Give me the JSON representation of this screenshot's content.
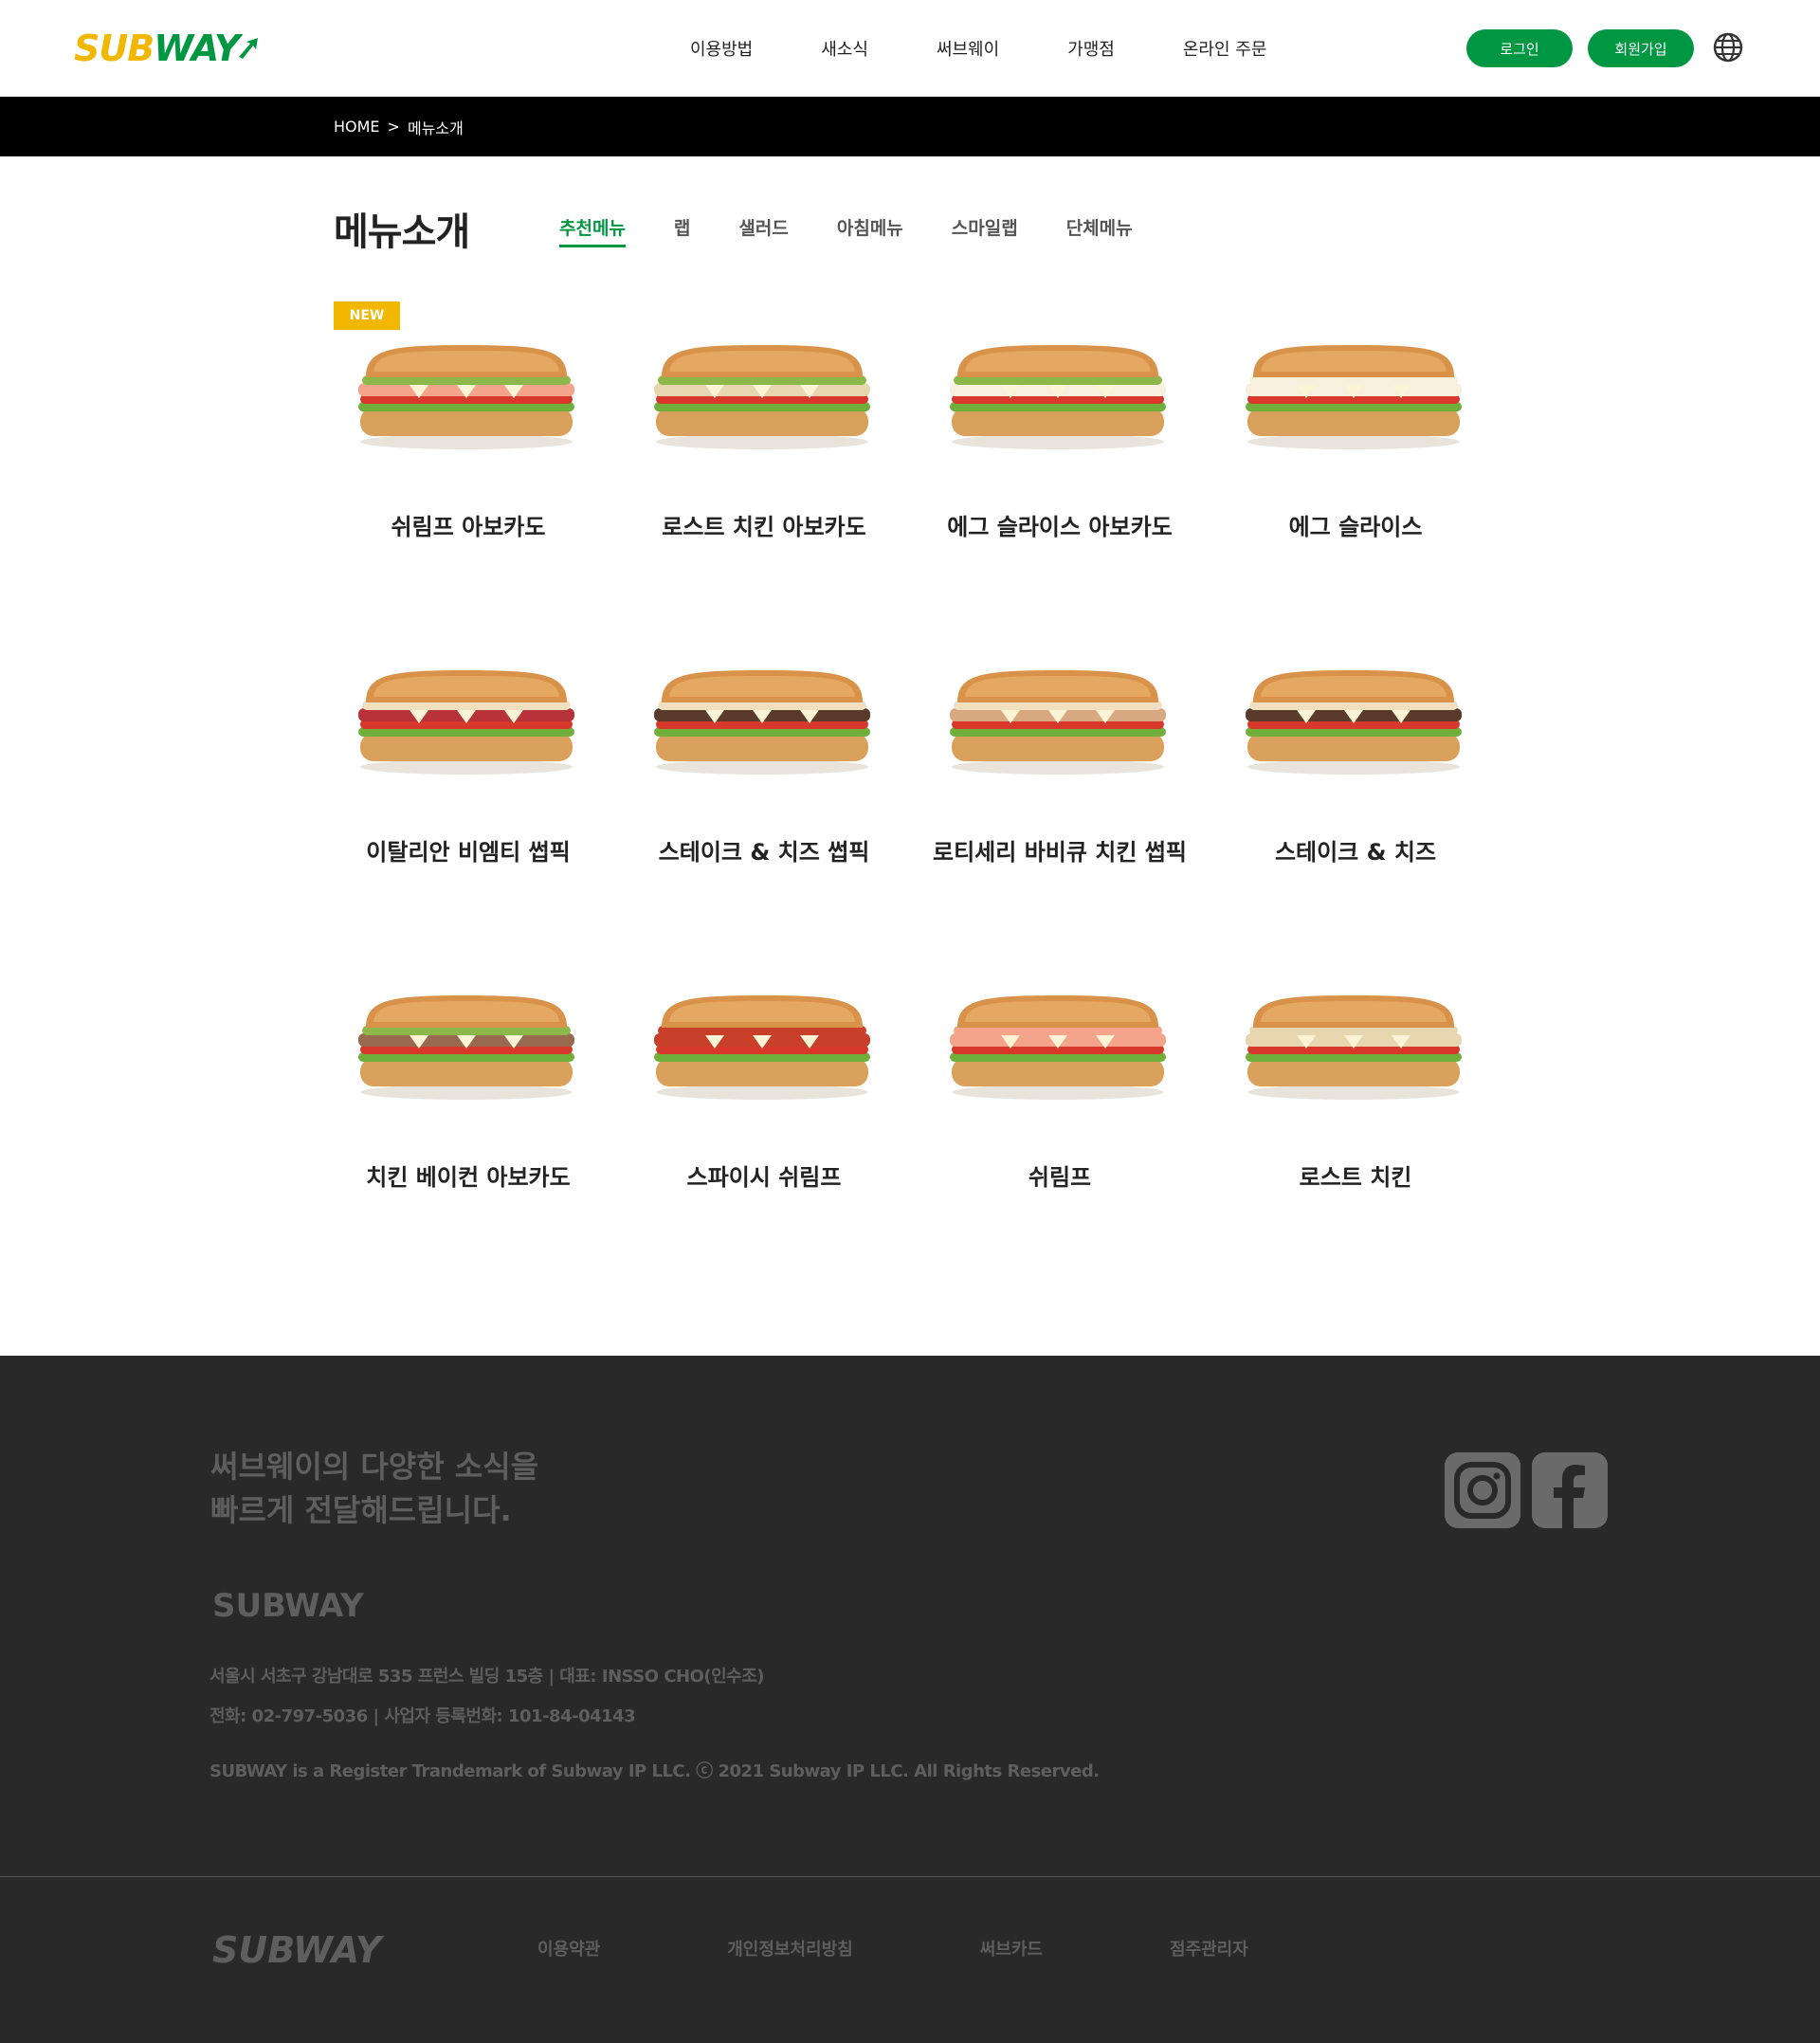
{
  "header": {
    "logo_left": "SUB",
    "logo_right": "WAY",
    "nav": [
      "이용방법",
      "새소식",
      "써브웨이",
      "가맹점",
      "온라인 주문"
    ],
    "login_label": "로그인",
    "join_label": "회원가입",
    "globe_icon": "globe-icon"
  },
  "breadcrumb": {
    "home": "HOME",
    "separator": ">",
    "current": "메뉴소개"
  },
  "page": {
    "title": "메뉴소개",
    "tabs": [
      "추천메뉴",
      "랩",
      "샐러드",
      "아침메뉴",
      "스마일랩",
      "단체메뉴"
    ],
    "active_tab": "추천메뉴"
  },
  "menu": {
    "badge": "NEW",
    "items": [
      {
        "name": "쉬림프 아보카도",
        "filling": "#f4a48a",
        "topping": "#8cb84a"
      },
      {
        "name": "로스트 치킨 아보카도",
        "filling": "#e8d6b0",
        "topping": "#8cb84a"
      },
      {
        "name": "에그 슬라이스 아보카도",
        "filling": "#f7f0dc",
        "topping": "#8cb84a"
      },
      {
        "name": "에그 슬라이스",
        "filling": "#f7f0dc",
        "topping": "#f7f0dc"
      },
      {
        "name": "이탈리안 비엠티 썹픽",
        "filling": "#b8323a",
        "topping": "#f0e0c0"
      },
      {
        "name": "스테이크 & 치즈 썹픽",
        "filling": "#5a3a2a",
        "topping": "#f0e0c0"
      },
      {
        "name": "로티세리 바비큐 치킨 썹픽",
        "filling": "#d8a880",
        "topping": "#f0e0c0"
      },
      {
        "name": "스테이크 & 치즈",
        "filling": "#5a3a2a",
        "topping": "#f0e0c0"
      },
      {
        "name": "치킨 베이컨 아보카도",
        "filling": "#9a6a50",
        "topping": "#8cb84a"
      },
      {
        "name": "스파이시 쉬림프",
        "filling": "#c8402a",
        "topping": "#c8402a"
      },
      {
        "name": "쉬림프",
        "filling": "#f4a48a",
        "topping": "#f4a48a"
      },
      {
        "name": "로스트 치킨",
        "filling": "#e8d6b0",
        "topping": "#e8d6b0"
      }
    ]
  },
  "footer": {
    "slogan_line1": "써브웨이의 다양한 소식을",
    "slogan_line2": "빠르게 전달해드립니다.",
    "brand": "SUBWAY",
    "address": "서울시 서초구 강남대로 535 프런스 빌딩 15층 | 대표: INSSO CHO(인수조)",
    "contact": "전화: 02-797-5036 | 사업자 등록번화: 101-84-04143",
    "copyright": "SUBWAY is a Register Trandemark of Subway IP LLC. ⓒ 2021 Subway IP LLC. All Rights Reserved.",
    "logo": "SUBWAY",
    "links": [
      "이용약관",
      "개인정보처리방침",
      "써브카드",
      "점주관리자"
    ],
    "social_icons": [
      "instagram-icon",
      "facebook-icon"
    ]
  },
  "colors": {
    "brand_green": "#009743",
    "brand_yellow": "#f2b700",
    "footer_bg": "#292929"
  }
}
